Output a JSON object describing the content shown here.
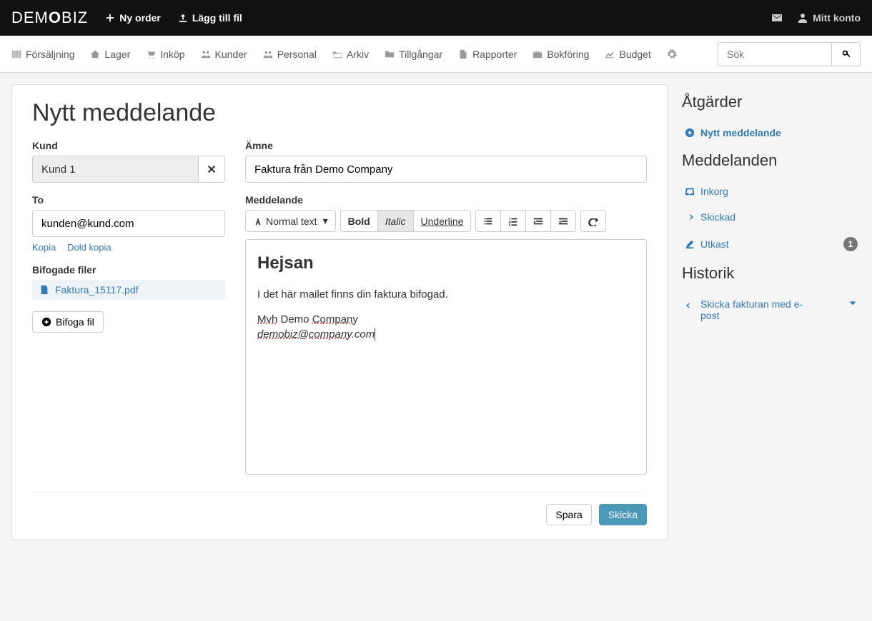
{
  "brand_prefix": "DEM",
  "brand_suffix": "BIZ",
  "topnav": {
    "new_order": "Ny order",
    "add_file": "Lägg till fil",
    "account": "Mitt konto"
  },
  "subnav": {
    "items": [
      "Försäljning",
      "Lager",
      "Inköp",
      "Kunder",
      "Personal",
      "Arkiv",
      "Tillgångar",
      "Rapporter",
      "Bokföring",
      "Budget"
    ],
    "search_placeholder": "Sök"
  },
  "page": {
    "title": "Nytt meddelande",
    "labels": {
      "customer": "Kund",
      "to": "To",
      "subject": "Ämne",
      "message": "Meddelande",
      "attached_files": "Bifogade filer"
    },
    "customer_value": "Kund 1",
    "to_value": "kunden@kund.com",
    "subject_value": "Faktura från Demo Company",
    "copy_link": "Kopia",
    "bcc_link": "Dold kopia",
    "attachment_name": "Faktura_15117.pdf",
    "attach_btn": "Bifoga fil",
    "toolbar": {
      "normal_text": "Normal text",
      "bold": "Bold",
      "italic": "Italic",
      "underline": "Underline"
    },
    "editor": {
      "heading": "Hejsan",
      "body": "I det här mailet finns din faktura bifogad.",
      "sig_line1_a": "Mvh",
      "sig_line1_b": " Demo ",
      "sig_line1_c": "Company",
      "sig_line2_a": "demobiz@company",
      "sig_line2_b": ".com"
    },
    "save_btn": "Spara",
    "send_btn": "Skicka"
  },
  "sidebar": {
    "actions_heading": "Åtgärder",
    "new_message": "Nytt meddelande",
    "messages_heading": "Meddelanden",
    "inbox": "Inkorg",
    "sent": "Skickad",
    "drafts": "Utkast",
    "drafts_count": "1",
    "history_heading": "Historik",
    "history_item": "Skicka fakturan med e-post"
  }
}
